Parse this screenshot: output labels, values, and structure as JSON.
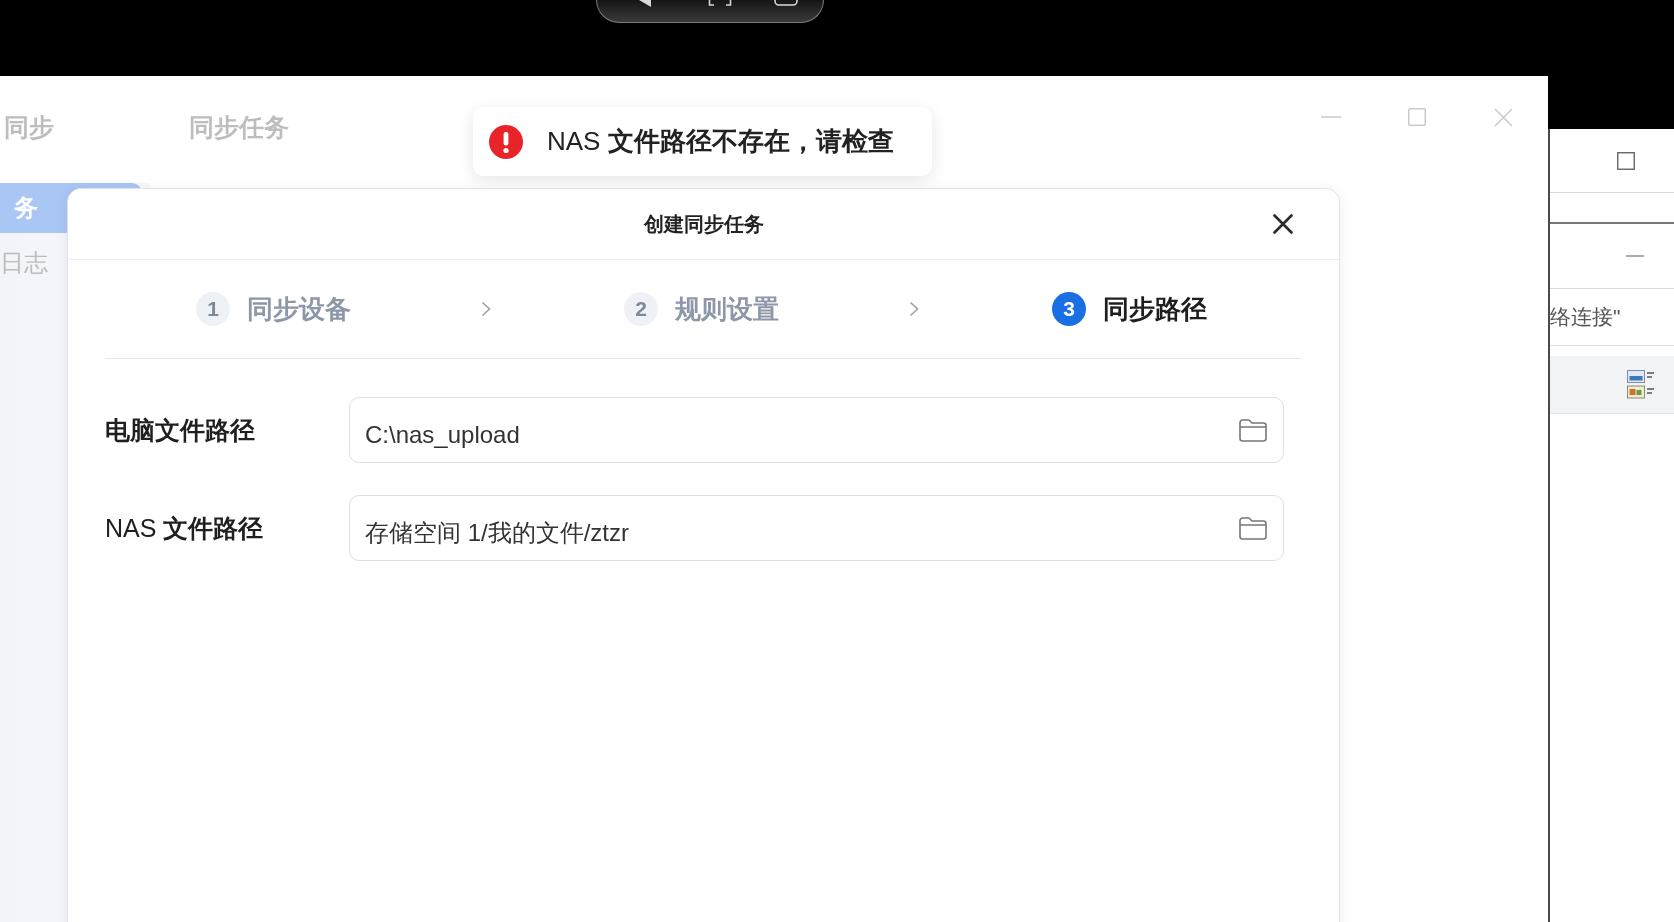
{
  "window": {
    "title": "同步",
    "page_title": "同步任务"
  },
  "sidebar": {
    "items": [
      {
        "label": "务",
        "selected": true
      },
      {
        "label": "日志",
        "selected": false
      }
    ]
  },
  "toast": {
    "kind": "error",
    "message": "NAS **文件路径不存在，请检查**"
  },
  "dialog": {
    "title": "创建同步任务",
    "steps": [
      {
        "number": "1",
        "label": "同步设备",
        "selected": false
      },
      {
        "number": "2",
        "label": "规则设置",
        "selected": false
      },
      {
        "number": "3",
        "label": "同步路径",
        "selected": true
      }
    ],
    "fields": [
      {
        "label": "**电脑文件路径**",
        "value": "C:\\nas_upload"
      },
      {
        "label": "NAS **文件路径**",
        "value": "存储空间 1/我的文件/ztzr"
      }
    ]
  },
  "background_window": {
    "row_text": "络连接\""
  }
}
